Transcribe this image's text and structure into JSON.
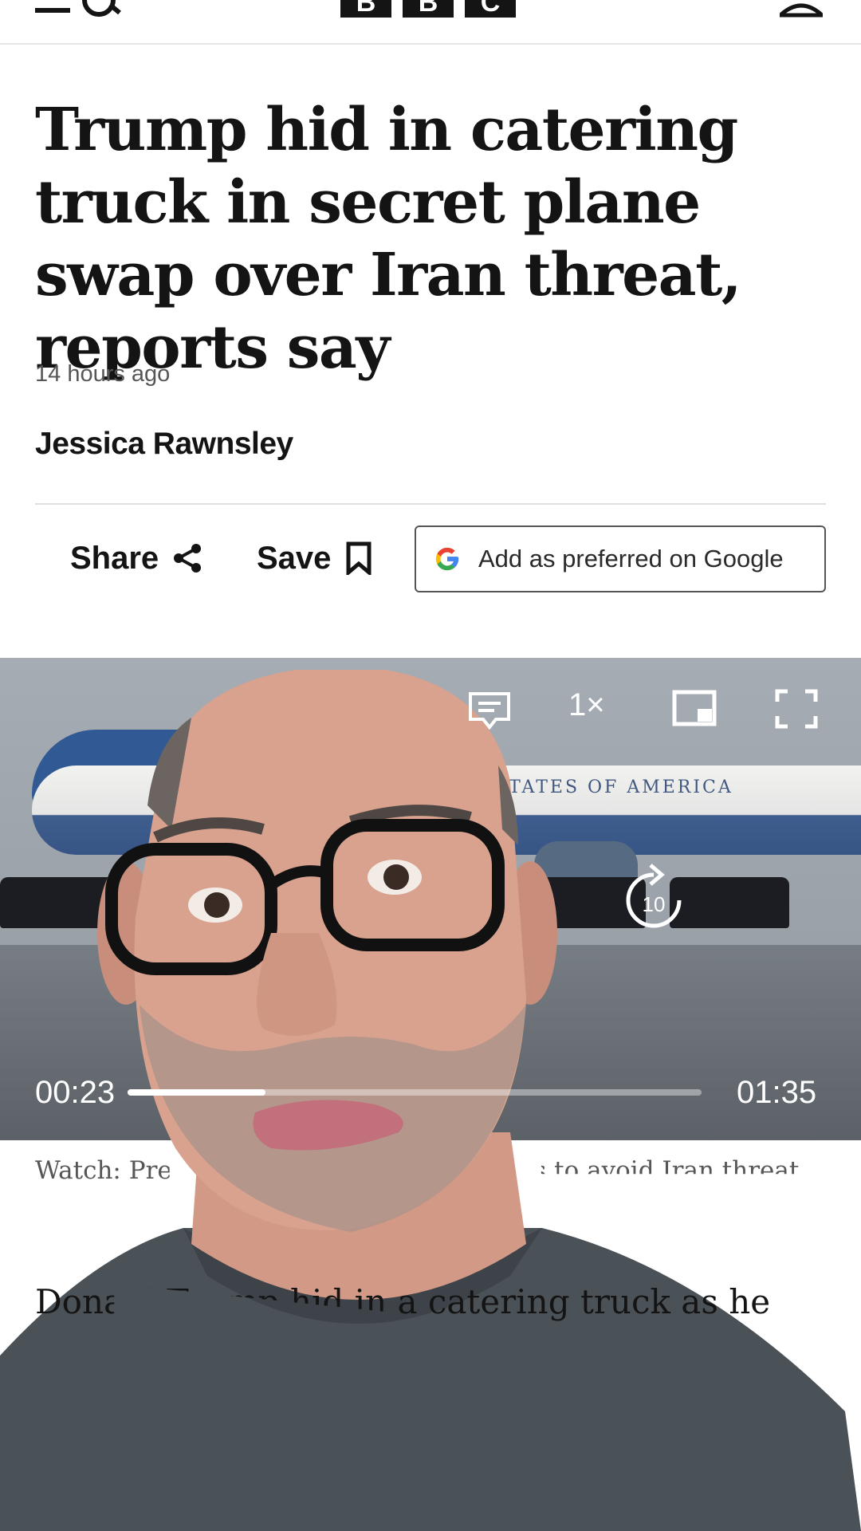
{
  "header": {
    "brand_letters": [
      "B",
      "B",
      "C"
    ],
    "menu_icon": "menu-icon",
    "search_icon": "search-icon",
    "account_icon": "account-icon"
  },
  "article": {
    "headline": "Trump hid in catering truck in secret plane swap over Iran threat, reports say",
    "timestamp": "14 hours ago",
    "byline": "Jessica Rawnsley",
    "actions": {
      "share_label": "Share",
      "save_label": "Save",
      "google_label": "Add as preferred on Google"
    }
  },
  "video": {
    "plane_text": "STATES OF AMERICA",
    "speed_label": "1×",
    "rewind_label": "10",
    "current_time": "00:23",
    "total_time": "01:35",
    "progress_fraction": 0.24,
    "caption": "Watch: President Trump switches planes to avoid Iran threat"
  },
  "body": {
    "first_paragraph": "Donald Trump hid in a catering truck as he left ... an"
  },
  "colors": {
    "text": "#141414",
    "muted": "#545658",
    "google_blue": "#4285F4",
    "google_red": "#EA4335",
    "google_yellow": "#FBBC05",
    "google_green": "#34A853"
  }
}
